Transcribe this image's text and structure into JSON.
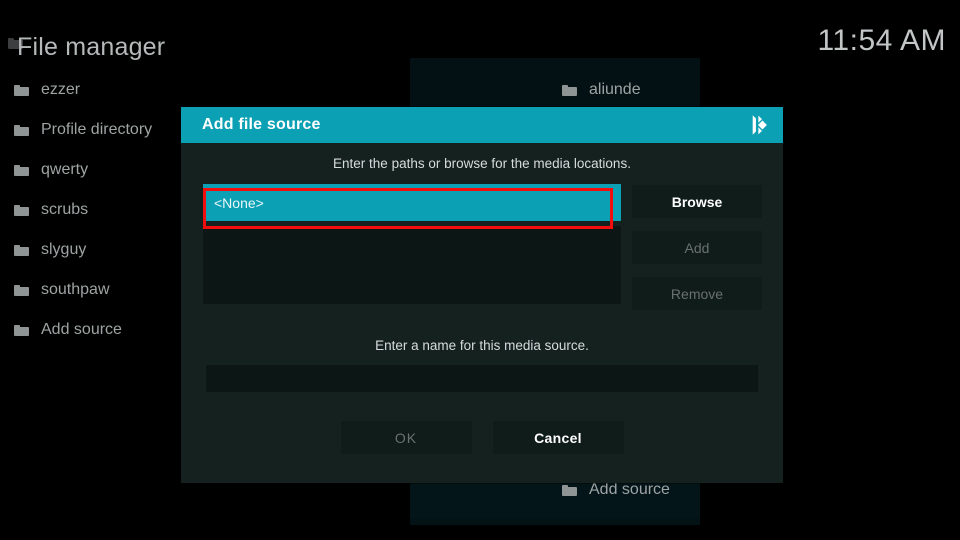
{
  "header": {
    "title": "File manager",
    "clock": "11:54 AM"
  },
  "file_manager": {
    "left_column": [
      {
        "label": "ezzer",
        "icon": "folder-icon"
      },
      {
        "label": "Profile directory",
        "icon": "folder-icon"
      },
      {
        "label": "qwerty",
        "icon": "folder-icon"
      },
      {
        "label": "scrubs",
        "icon": "folder-icon"
      },
      {
        "label": "slyguy",
        "icon": "folder-icon"
      },
      {
        "label": "southpaw",
        "icon": "folder-icon"
      },
      {
        "label": "Add source",
        "icon": "folder-icon"
      }
    ],
    "right_column": [
      {
        "label": "aliunde",
        "icon": "folder-icon"
      },
      {
        "label": "Add source",
        "icon": "folder-icon"
      }
    ]
  },
  "dialog": {
    "title": "Add file source",
    "logo": "kodi-logo-icon",
    "subtitle": "Enter the paths or browse for the media locations.",
    "path_value": "<None>",
    "side_buttons": [
      {
        "label": "Browse",
        "enabled": true
      },
      {
        "label": "Add",
        "enabled": false
      },
      {
        "label": "Remove",
        "enabled": false
      }
    ],
    "name_label": "Enter a name for this media source.",
    "name_value": "",
    "footer_buttons": [
      {
        "label": "OK",
        "enabled": false
      },
      {
        "label": "Cancel",
        "enabled": true
      }
    ]
  },
  "colors": {
    "accent_teal": "#0ca0b4",
    "dialog_bg": "#14211f",
    "annotation_red": "#f40d0d",
    "text_primary": "#ffffff",
    "text_muted": "#9ea3a4",
    "text_disabled": "#69716f"
  }
}
